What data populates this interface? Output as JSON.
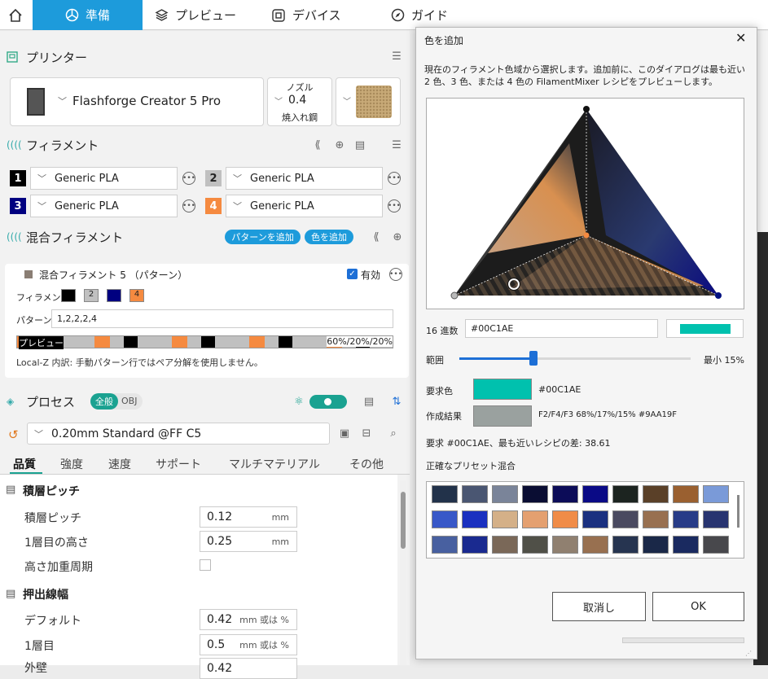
{
  "topbar": {
    "home_icon": "home-icon",
    "tabs": [
      {
        "label": "準備",
        "icon": "prepare-icon"
      },
      {
        "label": "プレビュー",
        "icon": "layers-icon"
      },
      {
        "label": "デバイス",
        "icon": "device-icon"
      },
      {
        "label": "ガイド",
        "icon": "compass-icon"
      }
    ]
  },
  "printer": {
    "header": "プリンター",
    "name": "Flashforge Creator 5 Pro",
    "nozzle_label": "ノズル",
    "nozzle_value": "0.4",
    "nozzle_type": "焼入れ鋼"
  },
  "filament": {
    "header": "フィラメント",
    "slots": [
      {
        "num": "1",
        "name": "Generic PLA",
        "color": "#000000",
        "text_color": "#ffffff"
      },
      {
        "num": "2",
        "name": "Generic PLA",
        "color": "#c0c0c0",
        "text_color": "#222222"
      },
      {
        "num": "3",
        "name": "Generic PLA",
        "color": "#000080",
        "text_color": "#ffffff"
      },
      {
        "num": "4",
        "name": "Generic PLA",
        "color": "#f58a40",
        "text_color": "#ffffff"
      }
    ]
  },
  "mixed": {
    "header": "混合フィラメント",
    "add_pattern_button": "パターンを追加",
    "add_color_button": "色を追加",
    "item_title": "混合フィラメント 5 （パターン）",
    "enabled_label": "有効",
    "enabled": true,
    "filament_label": "フィラメント",
    "chips": [
      "",
      "2",
      "",
      "4"
    ],
    "pattern_label": "パターン",
    "pattern_value": "1,2,2,2,4",
    "preview_label": "プレビュー",
    "preview_ratio": "60%/20%/20%",
    "note": "Local-Z 内訳: 手動パターン行ではペア分解を使用しません。"
  },
  "process": {
    "header": "プロセス",
    "toggle_all": "全般",
    "toggle_obj": "OBJ",
    "preset": "0.20mm Standard @FF C5",
    "tabs": [
      "品質",
      "強度",
      "速度",
      "サポート",
      "マルチマテリアル",
      "その他"
    ],
    "groups": [
      {
        "title": "積層ピッチ",
        "rows": [
          {
            "label": "積層ピッチ",
            "value": "0.12",
            "unit": "mm"
          },
          {
            "label": "1層目の高さ",
            "value": "0.25",
            "unit": "mm"
          },
          {
            "label": "高さ加重周期",
            "value": "",
            "unit": ""
          }
        ]
      },
      {
        "title": "押出線幅",
        "rows": [
          {
            "label": "デフォルト",
            "value": "0.42",
            "unit": "mm 或は %"
          },
          {
            "label": "1層目",
            "value": "0.5",
            "unit": "mm 或は %"
          },
          {
            "label": "外壁",
            "value": "0.42",
            "unit": ""
          }
        ]
      }
    ]
  },
  "dialog": {
    "title": "色を追加",
    "description": "現在のフィラメント色域から選択します。追加前に、このダイアログは最も近い 2 色、3 色、または 4 色の FilamentMixer レシピをプレビューします。",
    "hex_label": "16 進数",
    "hex_value": "#00C1AE",
    "preview_color": "#00C1AE",
    "range_label": "範囲",
    "range_min_label": "最小 15%",
    "range_fraction": 0.32,
    "requested_label": "要求色",
    "requested_hex": "#00C1AE",
    "requested_color": "#00C1AE",
    "result_label": "作成結果",
    "result_text": "F2/F4/F3 68%/17%/15%  #9AA19F",
    "result_color": "#9AA19F",
    "diff_text": "要求 #00C1AE、最も近いレシピの差: 38.61",
    "preset_label": "正確なプリセット混合",
    "presets": [
      "#22324a",
      "#4a5672",
      "#7a8499",
      "#0a0d33",
      "#0c0c58",
      "#0a0a86",
      "#1c2420",
      "#5a4028",
      "#9a6030",
      "#7a9ad8",
      "#3858c8",
      "#1a30c0",
      "#d4b088",
      "#e4a070",
      "#f08c48",
      "#1a3080",
      "#4a4a60",
      "#987050",
      "#283c88",
      "#283470",
      "#4860a0",
      "#1a2a90",
      "#7a6858",
      "#505048",
      "#908070",
      "#987050",
      "#263450",
      "#1a2848",
      "#1a2a60",
      "#48484c"
    ],
    "cancel_button": "取消し",
    "ok_button": "OK",
    "close_icon": "close-icon"
  }
}
